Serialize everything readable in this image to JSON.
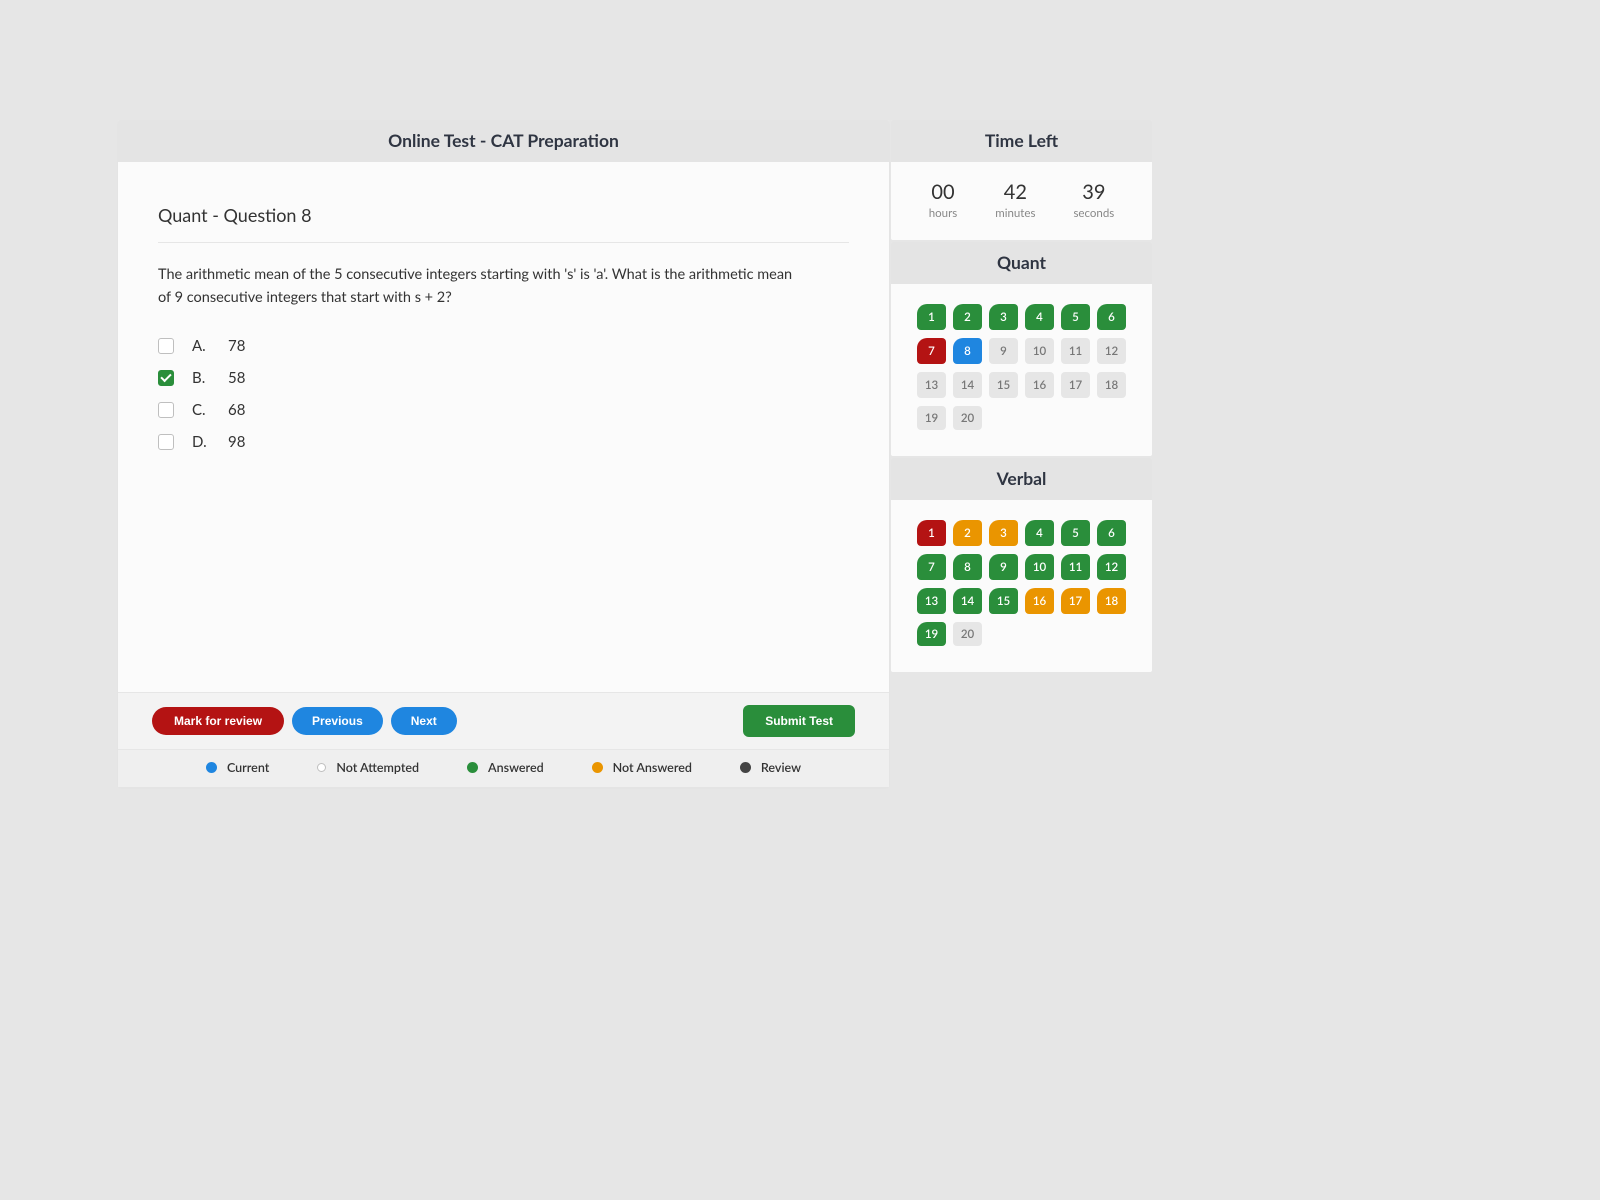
{
  "header": {
    "title": "Online Test - CAT Preparation"
  },
  "question": {
    "title": "Quant - Question 8",
    "text": "The arithmetic mean of the 5 consecutive integers starting with 's' is 'a'. What is the arithmetic mean of 9 consecutive integers that start with s + 2?",
    "options": [
      {
        "letter": "A.",
        "text": "78",
        "checked": false
      },
      {
        "letter": "B.",
        "text": "58",
        "checked": true
      },
      {
        "letter": "C.",
        "text": "68",
        "checked": false
      },
      {
        "letter": "D.",
        "text": "98",
        "checked": false
      }
    ]
  },
  "footer": {
    "mark": "Mark for review",
    "prev": "Previous",
    "next": "Next",
    "submit": "Submit Test"
  },
  "legend": {
    "current": "Current",
    "not_attempted": "Not Attempted",
    "answered": "Answered",
    "not_answered": "Not Answered",
    "review": "Review"
  },
  "timer": {
    "title": "Time Left",
    "hours": "00",
    "h_label": "hours",
    "minutes": "42",
    "m_label": "minutes",
    "seconds": "39",
    "s_label": "seconds"
  },
  "sections": {
    "quant": {
      "title": "Quant",
      "cells": [
        {
          "n": "1",
          "s": "green"
        },
        {
          "n": "2",
          "s": "green"
        },
        {
          "n": "3",
          "s": "green"
        },
        {
          "n": "4",
          "s": "green"
        },
        {
          "n": "5",
          "s": "green"
        },
        {
          "n": "6",
          "s": "green"
        },
        {
          "n": "7",
          "s": "red"
        },
        {
          "n": "8",
          "s": "blue"
        },
        {
          "n": "9",
          "s": "grey"
        },
        {
          "n": "10",
          "s": "grey"
        },
        {
          "n": "11",
          "s": "grey"
        },
        {
          "n": "12",
          "s": "grey"
        },
        {
          "n": "13",
          "s": "grey"
        },
        {
          "n": "14",
          "s": "grey"
        },
        {
          "n": "15",
          "s": "grey"
        },
        {
          "n": "16",
          "s": "grey"
        },
        {
          "n": "17",
          "s": "grey"
        },
        {
          "n": "18",
          "s": "grey"
        },
        {
          "n": "19",
          "s": "grey"
        },
        {
          "n": "20",
          "s": "grey"
        }
      ]
    },
    "verbal": {
      "title": "Verbal",
      "cells": [
        {
          "n": "1",
          "s": "red"
        },
        {
          "n": "2",
          "s": "orange"
        },
        {
          "n": "3",
          "s": "orange"
        },
        {
          "n": "4",
          "s": "green"
        },
        {
          "n": "5",
          "s": "green"
        },
        {
          "n": "6",
          "s": "green"
        },
        {
          "n": "7",
          "s": "green"
        },
        {
          "n": "8",
          "s": "green"
        },
        {
          "n": "9",
          "s": "green"
        },
        {
          "n": "10",
          "s": "green"
        },
        {
          "n": "11",
          "s": "green"
        },
        {
          "n": "12",
          "s": "green"
        },
        {
          "n": "13",
          "s": "green"
        },
        {
          "n": "14",
          "s": "green"
        },
        {
          "n": "15",
          "s": "green"
        },
        {
          "n": "16",
          "s": "orange"
        },
        {
          "n": "17",
          "s": "orange"
        },
        {
          "n": "18",
          "s": "orange"
        },
        {
          "n": "19",
          "s": "green"
        },
        {
          "n": "20",
          "s": "grey"
        }
      ]
    }
  }
}
